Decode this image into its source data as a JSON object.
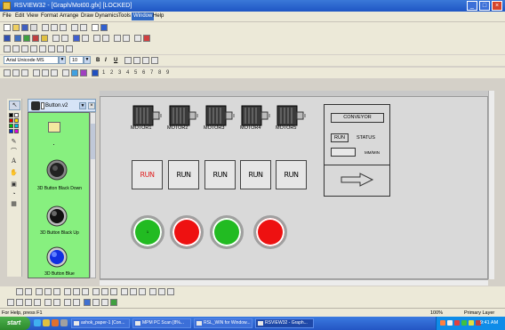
{
  "window": {
    "title": "RSVIEW32 - [Graph/Mot00.gfx] [LOCKED]",
    "controls": [
      "minimize",
      "maximize",
      "close"
    ]
  },
  "menu": [
    {
      "label": "File"
    },
    {
      "label": "Edit"
    },
    {
      "label": "View"
    },
    {
      "label": "Format"
    },
    {
      "label": "Arrange"
    },
    {
      "label": "Draw"
    },
    {
      "label": "Dynamics"
    },
    {
      "label": "Tools"
    },
    {
      "label": "Window",
      "active": true
    },
    {
      "label": "Help"
    }
  ],
  "format_toolbar": {
    "font": "Arial Unicode MS",
    "size": "10",
    "bold": "B",
    "italic": "I",
    "underline": "U"
  },
  "zoom_levels": [
    "1",
    "2",
    "3",
    "4",
    "5",
    "6",
    "7",
    "8",
    "9"
  ],
  "library": {
    "title": "Button.v2",
    "items": [
      {
        "label": "3D Button Black Down",
        "icon": "black-3d-button-icon"
      },
      {
        "label": "3D Button Black Up",
        "icon": "black-3d-button-icon"
      },
      {
        "label": "3D Button Blue",
        "icon": "blue-3d-button-icon"
      }
    ]
  },
  "motors": [
    {
      "label": "MOTOR1"
    },
    {
      "label": "MOTOR2"
    },
    {
      "label": "MOTOR3"
    },
    {
      "label": "MOTOR4"
    },
    {
      "label": "MOTOR5"
    }
  ],
  "run_buttons": [
    {
      "label": "RUN",
      "color": "#e02020"
    },
    {
      "label": "RUN",
      "color": "#000000"
    },
    {
      "label": "RUN",
      "color": "#000000"
    },
    {
      "label": "RUN",
      "color": "#000000"
    },
    {
      "label": "RUN",
      "color": "#000000"
    }
  ],
  "indicators": [
    {
      "state": "on",
      "color": "#22bb22",
      "label": "1"
    },
    {
      "state": "off",
      "color": "#ee1111",
      "label": ""
    },
    {
      "state": "on",
      "color": "#22bb22",
      "label": ""
    },
    {
      "state": "off",
      "color": "#ee1111",
      "label": ""
    }
  ],
  "conveyor": {
    "title": "CONVEYOR",
    "run_label": "RUN",
    "status_label": "STATUS",
    "speed_unit": "MM/MIN",
    "arrow_icon": "right-arrow-icon"
  },
  "statusbar": {
    "help": "For Help, press F1",
    "zoom": "100%",
    "layer": "Primary Layer"
  },
  "taskbar": {
    "start": "start",
    "items": [
      {
        "label": "ashok_paper-1 [Con...",
        "active": false
      },
      {
        "label": "MPM PC Scan [8%...",
        "active": false
      },
      {
        "label": "RSL_WIN for Window...",
        "active": false
      },
      {
        "label": "RSVIEW32 - Graph...",
        "active": true
      }
    ],
    "clock": "9:41 AM"
  }
}
